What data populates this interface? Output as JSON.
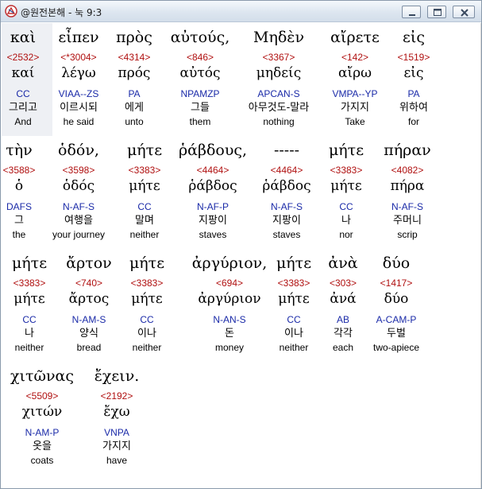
{
  "window": {
    "title": "@원전본해 - 눅 9:3"
  },
  "rows": [
    {
      "tokens": [
        {
          "greek": "καὶ",
          "strong": "<2532>",
          "lemma": "καί",
          "parse": "CC",
          "korean": "그리고",
          "english": "And"
        },
        {
          "greek": "εἶπεν",
          "strong": "<*3004>",
          "lemma": "λέγω",
          "parse": "VIAA--ZS",
          "korean": "이르시되",
          "english": "he said"
        },
        {
          "greek": "πρὸς",
          "strong": "<4314>",
          "lemma": "πρός",
          "parse": "PA",
          "korean": "에게",
          "english": "unto"
        },
        {
          "greek": "αὐτούς,",
          "strong": "<846>",
          "lemma": "αὐτός",
          "parse": "NPAMZP",
          "korean": "그들",
          "english": "them"
        },
        {
          "greek": "Μηδὲν",
          "strong": "<3367>",
          "lemma": "μηδείς",
          "parse": "APCAN-S",
          "korean": "아무것도-말라",
          "english": "nothing"
        },
        {
          "greek": "αἴρετε",
          "strong": "<142>",
          "lemma": "αἴρω",
          "parse": "VMPA--YP",
          "korean": "가지지",
          "english": "Take"
        },
        {
          "greek": "εἰς",
          "strong": "<1519>",
          "lemma": "εἰς",
          "parse": "PA",
          "korean": "위하여",
          "english": "for"
        }
      ]
    },
    {
      "tokens": [
        {
          "greek": "τὴν",
          "strong": "<3588>",
          "lemma": "ὁ",
          "parse": "DAFS",
          "korean": "그",
          "english": "the"
        },
        {
          "greek": "ὁδόν,",
          "strong": "<3598>",
          "lemma": "ὁδός",
          "parse": "N-AF-S",
          "korean": "여행을",
          "english": "your journey"
        },
        {
          "greek": "μήτε",
          "strong": "<3383>",
          "lemma": "μήτε",
          "parse": "CC",
          "korean": "말며",
          "english": "neither"
        },
        {
          "greek": "ῥάβδους,",
          "strong": "<4464>",
          "lemma": "ῥάβδος",
          "parse": "N-AF-P",
          "korean": "지팡이",
          "english": "staves"
        },
        {
          "greek": "-----",
          "strong": "<4464>",
          "lemma": "ῥάβδος",
          "parse": "N-AF-S",
          "korean": "지팡이",
          "english": "staves"
        },
        {
          "greek": "μήτε",
          "strong": "<3383>",
          "lemma": "μήτε",
          "parse": "CC",
          "korean": "나",
          "english": "nor"
        },
        {
          "greek": "πήραν",
          "strong": "<4082>",
          "lemma": "πήρα",
          "parse": "N-AF-S",
          "korean": "주머니",
          "english": "scrip"
        }
      ]
    },
    {
      "tokens": [
        {
          "greek": "μήτε",
          "strong": "<3383>",
          "lemma": "μήτε",
          "parse": "CC",
          "korean": "나",
          "english": "neither"
        },
        {
          "greek": "ἄρτον",
          "strong": "<740>",
          "lemma": "ἄρτος",
          "parse": "N-AM-S",
          "korean": "양식",
          "english": "bread"
        },
        {
          "greek": "μήτε",
          "strong": "<3383>",
          "lemma": "μήτε",
          "parse": "CC",
          "korean": "이나",
          "english": "neither"
        },
        {
          "greek": "ἀργύριον,",
          "strong": "<694>",
          "lemma": "ἀργύριον",
          "parse": "N-AN-S",
          "korean": "돈",
          "english": "money"
        },
        {
          "greek": "μήτε",
          "strong": "<3383>",
          "lemma": "μήτε",
          "parse": "CC",
          "korean": "이나",
          "english": "neither"
        },
        {
          "greek": "ἀνὰ",
          "strong": "<303>",
          "lemma": "ἀνά",
          "parse": "AB",
          "korean": "각각",
          "english": "each"
        },
        {
          "greek": "δύο",
          "strong": "<1417>",
          "lemma": "δύο",
          "parse": "A-CAM-P",
          "korean": "두벌",
          "english": "two-apiece"
        }
      ]
    },
    {
      "tokens": [
        {
          "greek": "χιτῶνας",
          "strong": "<5509>",
          "lemma": "χιτών",
          "parse": "N-AM-P",
          "korean": "옷을",
          "english": "coats"
        },
        {
          "greek": "ἔχειν.",
          "strong": "<2192>",
          "lemma": "ἔχω",
          "parse": "VNPA",
          "korean": "가지지",
          "english": "have"
        }
      ]
    }
  ],
  "colors": {
    "strong": "#b01010",
    "parse": "#1a2aa8",
    "text": "#000000",
    "selection": "#eef0f4"
  },
  "icons": {
    "app": "app-icon",
    "minimize": "minimize-icon",
    "maximize": "maximize-icon",
    "close": "close-icon"
  }
}
